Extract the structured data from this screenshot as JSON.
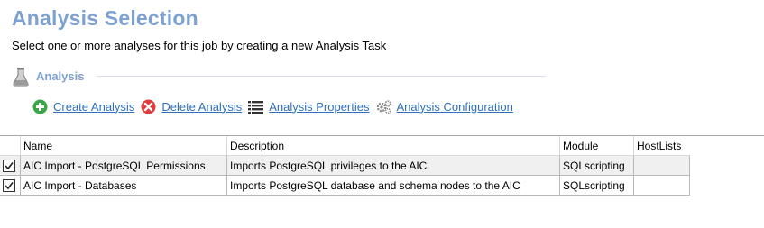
{
  "header": {
    "title": "Analysis Selection",
    "subtitle": "Select one or more analyses for this job by creating a new Analysis Task"
  },
  "section": {
    "label": "Analysis",
    "icon": "flask-icon"
  },
  "toolbar": {
    "create_label": "Create Analysis",
    "delete_label": "Delete Analysis",
    "properties_label": "Analysis Properties",
    "configuration_label": "Analysis Configuration"
  },
  "grid": {
    "columns": [
      "Name",
      "Description",
      "Module",
      "HostLists"
    ],
    "rows": [
      {
        "checked": true,
        "name": "AIC Import - PostgreSQL Permissions",
        "description": "Imports PostgreSQL privileges to the AIC",
        "module": "SQLscripting",
        "hostlists": ""
      },
      {
        "checked": true,
        "name": "AIC Import - Databases",
        "description": "Imports PostgreSQL database and schema nodes to the AIC",
        "module": "SQLscripting",
        "hostlists": ""
      }
    ]
  },
  "colors": {
    "title": "#7ea1d3",
    "link": "#2f6fbf",
    "add": "#3aa64a",
    "delete": "#e23b3b"
  }
}
